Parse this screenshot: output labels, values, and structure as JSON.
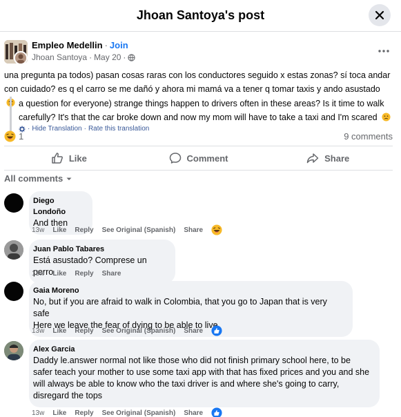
{
  "header": {
    "title": "Jhoan Santoya's post"
  },
  "post": {
    "group_name": "Empleo Medellin",
    "join_label": "Join",
    "author": "Jhoan Santoya",
    "date": "May 20",
    "text": "una pregunta pa todos) pasan cosas raras con los conductores seguido x estas zonas? sí toca andar con cuidado? es q el carro se me dañó y ahora mi mamá va a tener q tomar taxis y ando asustado",
    "translation": "a question for everyone) strange things happen to drivers often in these areas? Is it time to walk carefully? It's that the car broke down and now my mom will have to take a taxi and I'm scared",
    "hide_translation": "Hide Translation",
    "rate_translation": "Rate this translation",
    "reaction_count": "1",
    "comments_count": "9 comments"
  },
  "actions": {
    "like": "Like",
    "comment": "Comment",
    "share": "Share"
  },
  "comments_filter": "All comments",
  "comment_actions": {
    "like": "Like",
    "reply": "Reply",
    "see_original": "See Original (Spanish)",
    "share": "Share"
  },
  "comments": [
    {
      "name": "Diego Londoño",
      "text": "And then",
      "time": "13w",
      "reaction": "haha"
    },
    {
      "name": "Juan Pablo Tabares",
      "text": "Está asustado? Comprese un perro",
      "time": "13w",
      "reaction": ""
    },
    {
      "name": "Gaia Moreno",
      "text": "No, but if you are afraid to walk in Colombia, that you go to Japan that is very safe\nHere we leave the fear of dying to be able to live",
      "time": "13w",
      "reaction": "like"
    },
    {
      "name": "Alex Garcia",
      "text": "Daddy le.answer normal not like those who did not finish primary school here, to be safer teach your mother to use some taxi app with that has fixed prices and you and she will always be able to know who the taxi driver is and where she's going to carry, disregard the tops",
      "time": "13w",
      "reaction": "like"
    }
  ],
  "colors": {
    "accent": "#1877f2",
    "secondary_text": "#65676b",
    "bubble": "#f0f2f5"
  },
  "icons": [
    "close-icon",
    "globe-icon",
    "more-icon",
    "gear-icon",
    "like-icon",
    "comment-icon",
    "share-icon",
    "chevron-down-icon",
    "haha-icon",
    "sad-icon",
    "like-reaction-icon"
  ]
}
